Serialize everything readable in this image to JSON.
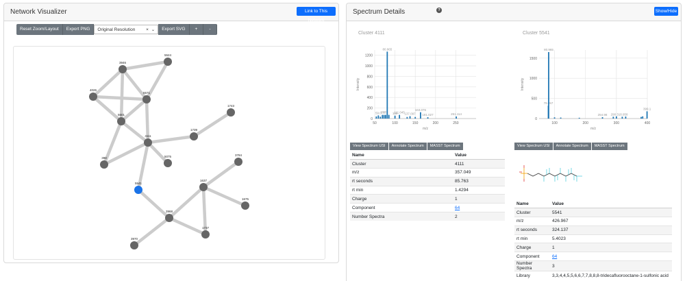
{
  "left_panel": {
    "title": "Network Visualizer",
    "link_button": "Link to This Network",
    "toolbar": {
      "reset": "Reset Zoom/Layout",
      "export_png": "Export PNG",
      "resolution": "Original Resolution",
      "export_svg": "Export SVG",
      "plus": "+",
      "minus": "-"
    }
  },
  "network": {
    "nodes": [
      {
        "id": "5524",
        "highlight": false
      },
      {
        "id": "3946",
        "highlight": false
      },
      {
        "id": "4026",
        "highlight": false
      },
      {
        "id": "5571",
        "highlight": false
      },
      {
        "id": "5601",
        "highlight": false
      },
      {
        "id": "1743",
        "highlight": false
      },
      {
        "id": "1739",
        "highlight": false
      },
      {
        "id": "4111",
        "highlight": false
      },
      {
        "id": "398",
        "highlight": false
      },
      {
        "id": "5075",
        "highlight": false
      },
      {
        "id": "3784",
        "highlight": false
      },
      {
        "id": "5541",
        "highlight": true
      },
      {
        "id": "1637",
        "highlight": false
      },
      {
        "id": "1675",
        "highlight": false
      },
      {
        "id": "3968",
        "highlight": false
      },
      {
        "id": "1737",
        "highlight": false
      },
      {
        "id": "3970",
        "highlight": false
      }
    ],
    "edges": [
      [
        "3946",
        "5524"
      ],
      [
        "3946",
        "5571"
      ],
      [
        "3946",
        "4026"
      ],
      [
        "3946",
        "5601"
      ],
      [
        "5524",
        "5571"
      ],
      [
        "4026",
        "5571"
      ],
      [
        "4026",
        "5601"
      ],
      [
        "5571",
        "5601"
      ],
      [
        "5571",
        "4111"
      ],
      [
        "5601",
        "4111"
      ],
      [
        "5601",
        "398"
      ],
      [
        "1743",
        "1739"
      ],
      [
        "1739",
        "4111"
      ],
      [
        "4111",
        "398"
      ],
      [
        "4111",
        "5075"
      ],
      [
        "4111",
        "5541"
      ],
      [
        "3784",
        "1637"
      ],
      [
        "1637",
        "1675"
      ],
      [
        "1637",
        "3968"
      ],
      [
        "1637",
        "1737"
      ],
      [
        "5541",
        "3968"
      ],
      [
        "3968",
        "1737"
      ],
      [
        "3968",
        "3970"
      ]
    ],
    "colors": {
      "node": "#666666",
      "highlight": "#1a73e8",
      "edge": "#cccccc"
    }
  },
  "right_panel": {
    "title": "Spectrum Details",
    "help": "?",
    "show_hide": "Show/Hide"
  },
  "spectra": [
    {
      "title": "Cluster 4111",
      "buttons": [
        "View Spectrum USI",
        "Annotate Spectrum",
        "MASST Spectrum"
      ],
      "table_headers": [
        "Name",
        "Value"
      ],
      "rows": [
        {
          "name": "Cluster",
          "value": "4111",
          "link": false
        },
        {
          "name": "m/z",
          "value": "357.049",
          "link": false
        },
        {
          "name": "rt seconds",
          "value": "85.763",
          "link": false
        },
        {
          "name": "rt min",
          "value": "1.4294",
          "link": false
        },
        {
          "name": "Charge",
          "value": "1",
          "link": false
        },
        {
          "name": "Component",
          "value": "64",
          "link": true
        },
        {
          "name": "Number Spectra",
          "value": "2",
          "link": false
        }
      ]
    },
    {
      "title": "Cluster 5541",
      "buttons": [
        "View Spectrum USI",
        "Annotate Spectrum",
        "MASST Spectrum"
      ],
      "table_headers": [
        "Name",
        "Value"
      ],
      "rows": [
        {
          "name": "Cluster",
          "value": "5541",
          "link": false
        },
        {
          "name": "m/z",
          "value": "426.967",
          "link": false
        },
        {
          "name": "rt seconds",
          "value": "324.137",
          "link": false
        },
        {
          "name": "rt min",
          "value": "5.4023",
          "link": false
        },
        {
          "name": "Charge",
          "value": "1",
          "link": false
        },
        {
          "name": "Component",
          "value": "64",
          "link": true
        },
        {
          "name": "Number Spectra",
          "value": "3",
          "link": false
        },
        {
          "name": "Library",
          "value": "3,3,4,4,5,5,6,6,7,7,8,8,8-tridecafluorooctane-1-sulfonic acid",
          "link": false
        }
      ]
    }
  ],
  "chart_data": [
    {
      "type": "bar",
      "title": "Cluster 4111",
      "xlabel": "m/z",
      "ylabel": "Intensity",
      "xlim": [
        50,
        300
      ],
      "ylim": [
        0,
        1300
      ],
      "xticks": [
        50,
        100,
        150,
        200,
        250
      ],
      "yticks": [
        0,
        200,
        400,
        600,
        800,
        1000,
        1200
      ],
      "grid": true,
      "peaks": [
        {
          "x": 54,
          "y": 40,
          "label": ""
        },
        {
          "x": 59.0,
          "y": 60,
          "label": "59.0"
        },
        {
          "x": 64,
          "y": 35,
          "label": ""
        },
        {
          "x": 69,
          "y": 70,
          "label": "69"
        },
        {
          "x": 73,
          "y": 70,
          "label": "73"
        },
        {
          "x": 77,
          "y": 70,
          "label": "77"
        },
        {
          "x": 80.965,
          "y": 1270,
          "label": "80.965"
        },
        {
          "x": 85,
          "y": 70,
          "label": ""
        },
        {
          "x": 100,
          "y": 55,
          "label": "100"
        },
        {
          "x": 111.045,
          "y": 70,
          "label": "111.045"
        },
        {
          "x": 130,
          "y": 30,
          "label": ""
        },
        {
          "x": 137.097,
          "y": 45,
          "label": "137.097"
        },
        {
          "x": 150,
          "y": 30,
          "label": ""
        },
        {
          "x": 163.076,
          "y": 120,
          "label": "163.076"
        },
        {
          "x": 181.027,
          "y": 25,
          "label": "181.027"
        },
        {
          "x": 251.114,
          "y": 40,
          "label": "251.114"
        }
      ]
    },
    {
      "type": "bar",
      "title": "Cluster 5541",
      "xlabel": "m/z",
      "ylabel": "Intensity",
      "xlim": [
        50,
        400
      ],
      "ylim": [
        0,
        1700
      ],
      "xticks": [
        100,
        200,
        300,
        400
      ],
      "yticks": [
        0,
        500,
        1000,
        1500
      ],
      "grid": true,
      "peaks": [
        {
          "x": 79.957,
          "y": 320,
          "label": "79.957"
        },
        {
          "x": 80.965,
          "y": 1650,
          "label": "80.965"
        },
        {
          "x": 100,
          "y": 30,
          "label": ""
        },
        {
          "x": 120,
          "y": 25,
          "label": ""
        },
        {
          "x": 180,
          "y": 20,
          "label": ""
        },
        {
          "x": 254.987,
          "y": 35,
          "label": "254.98"
        },
        {
          "x": 290,
          "y": 45,
          "label": "290"
        },
        {
          "x": 300,
          "y": 55,
          "label": ""
        },
        {
          "x": 318.958,
          "y": 45,
          "label": "318.958"
        },
        {
          "x": 330,
          "y": 50,
          "label": ""
        },
        {
          "x": 380,
          "y": 40,
          "label": ""
        },
        {
          "x": 385,
          "y": 55,
          "label": ""
        },
        {
          "x": 399.1,
          "y": 180,
          "label": "399.1"
        }
      ]
    }
  ]
}
